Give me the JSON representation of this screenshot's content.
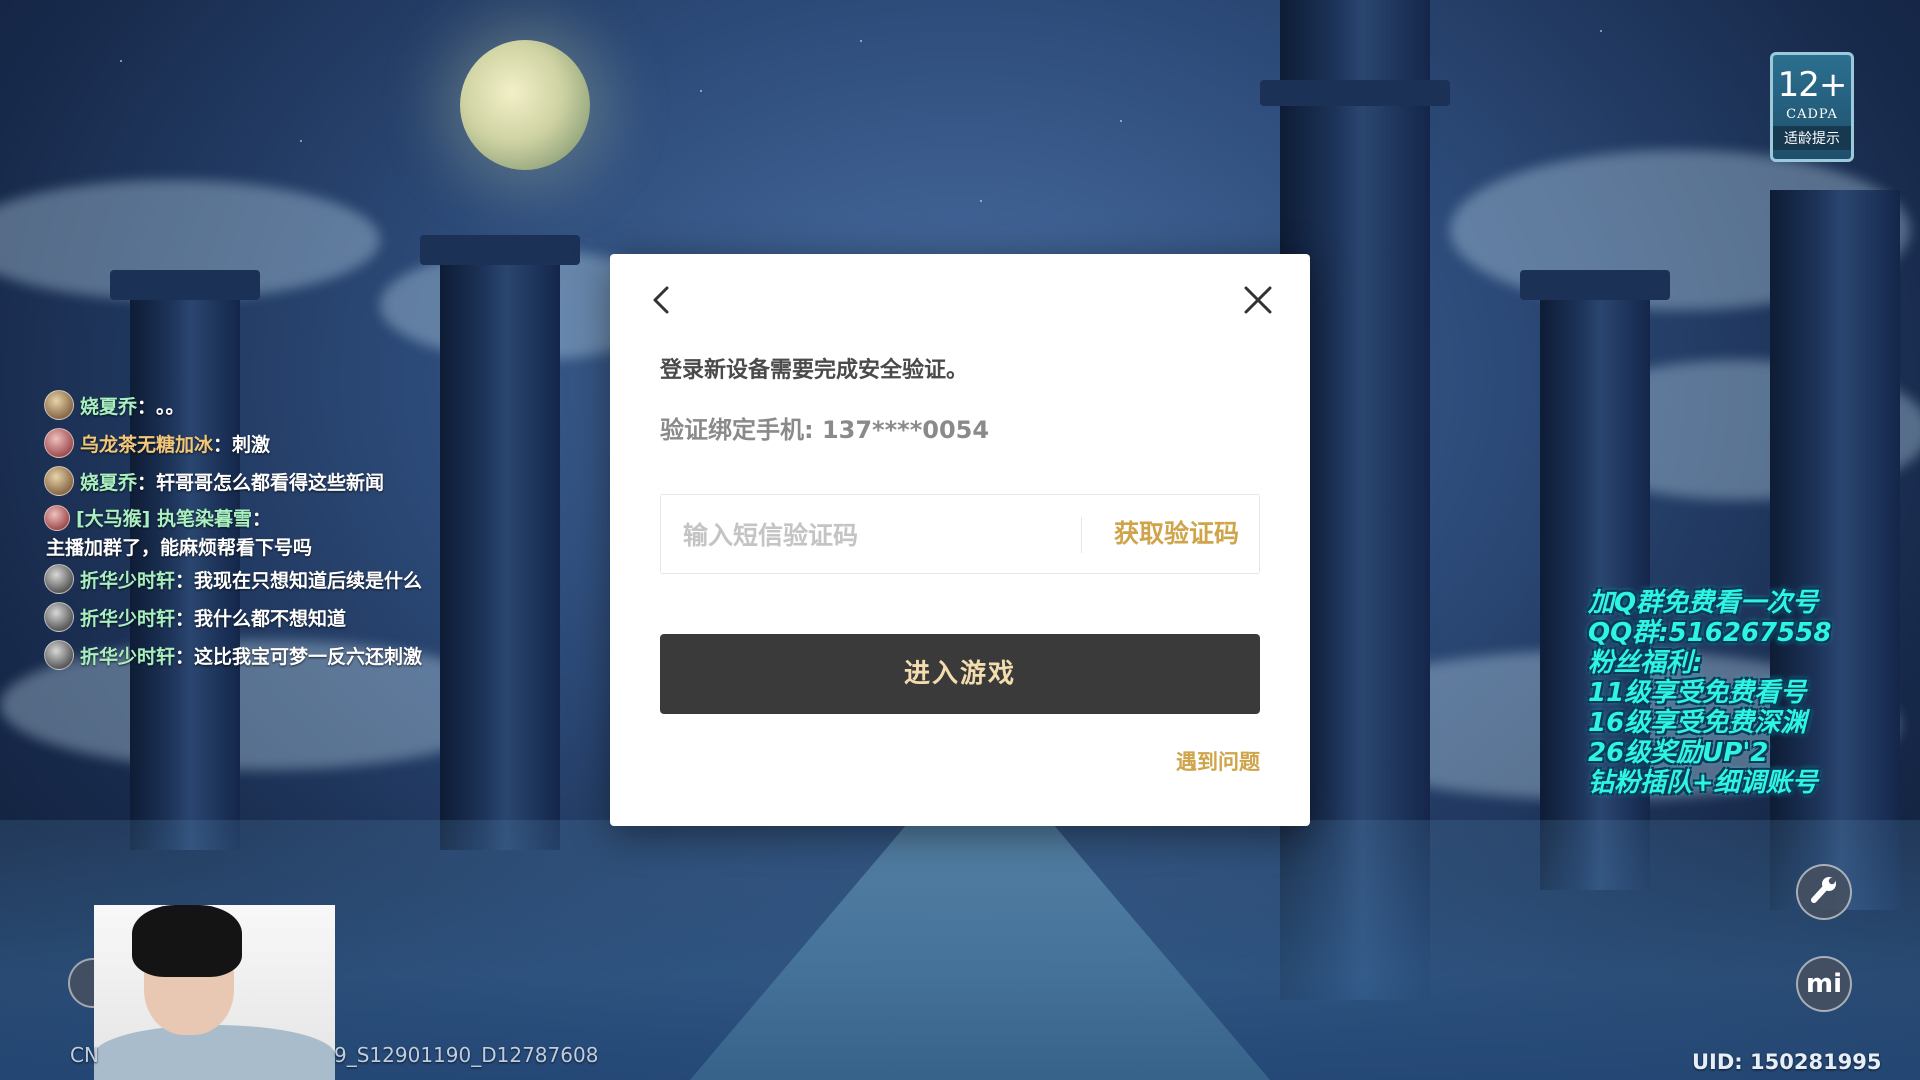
{
  "hud": {
    "age_rating": "12+",
    "age_org": "CADPA",
    "age_tip": "适龄提示",
    "uid": "UID: 150281995",
    "version_left": "CN",
    "version_right": "9_S12901190_D12787608"
  },
  "chat": [
    {
      "name": "娆夏乔",
      "sep": "：",
      "msg": "。。"
    },
    {
      "name": "乌龙茶无糖加冰",
      "sep": "：",
      "msg": "刺激"
    },
    {
      "name": "娆夏乔",
      "sep": "：",
      "msg": "轩哥哥怎么都看得这些新闻"
    },
    {
      "name": "[大马猴] 执笔染暮雪",
      "sep": "：",
      "msg": "主播加群了，能麻烦帮看下号吗"
    },
    {
      "name": "折华少时轩",
      "sep": "：",
      "msg": "我现在只想知道后续是什么"
    },
    {
      "name": "折华少时轩",
      "sep": "：",
      "msg": "我什么都不想知道"
    },
    {
      "name": "折华少时轩",
      "sep": "：",
      "msg": "这比我宝可梦一反六还刺激"
    }
  ],
  "modal": {
    "title": "登录新设备需要完成安全验证。",
    "phone": "验证绑定手机: 137****0054",
    "code_placeholder": "输入短信验证码",
    "code_value": "",
    "get_code_label": "获取验证码",
    "enter_label": "进入游戏",
    "help_label": "遇到问题"
  },
  "promo": [
    "加Q群免费看一次号",
    "QQ群:516267558",
    "粉丝福利:",
    " 11级享受免费看号",
    " 16级享受免费深渊",
    "26级奖励UP'2",
    "钻粉插队+细调账号"
  ],
  "icons": {
    "back": "chevron-left-icon",
    "close": "close-icon",
    "wrench": "wrench-icon",
    "mi": "mi-logo-icon"
  }
}
